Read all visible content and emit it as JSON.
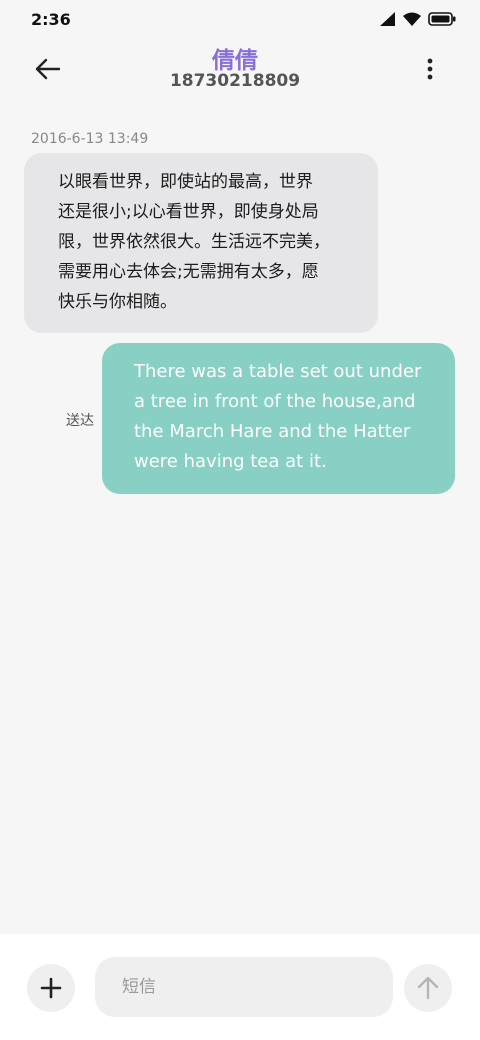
{
  "status_bar": {
    "time": "2:36",
    "icons": [
      "cellular-signal-icon",
      "wifi-icon",
      "battery-icon"
    ]
  },
  "header": {
    "back_icon": "arrow-left-icon",
    "contact_name": "倩倩",
    "contact_number": "18730218809",
    "more_icon": "more-vertical-icon"
  },
  "conversation": {
    "timestamp": "2016-6-13 13:49",
    "messages": [
      {
        "direction": "incoming",
        "lines": [
          "以眼看世界，即使站的最高，世界",
          "还是很小;以心看世界，即使身处局",
          "限，世界依然很大。生活远不完美，",
          "需要用心去体会;无需拥有太多，愿",
          "快乐与你相随。"
        ]
      },
      {
        "direction": "outgoing",
        "status": "送达",
        "lines": [
          "There was a table set out under",
          "a tree in front of the house,and",
          "the March Hare and the Hatter",
          "were having tea at it."
        ]
      }
    ]
  },
  "composer": {
    "add_icon": "plus-icon",
    "placeholder": "短信",
    "send_icon": "arrow-up-icon"
  },
  "colors": {
    "accent": "#8a6fd6",
    "outgoing_bubble": "#88d0c4",
    "incoming_bubble": "#e6e6e8",
    "background": "#f6f6f6"
  }
}
